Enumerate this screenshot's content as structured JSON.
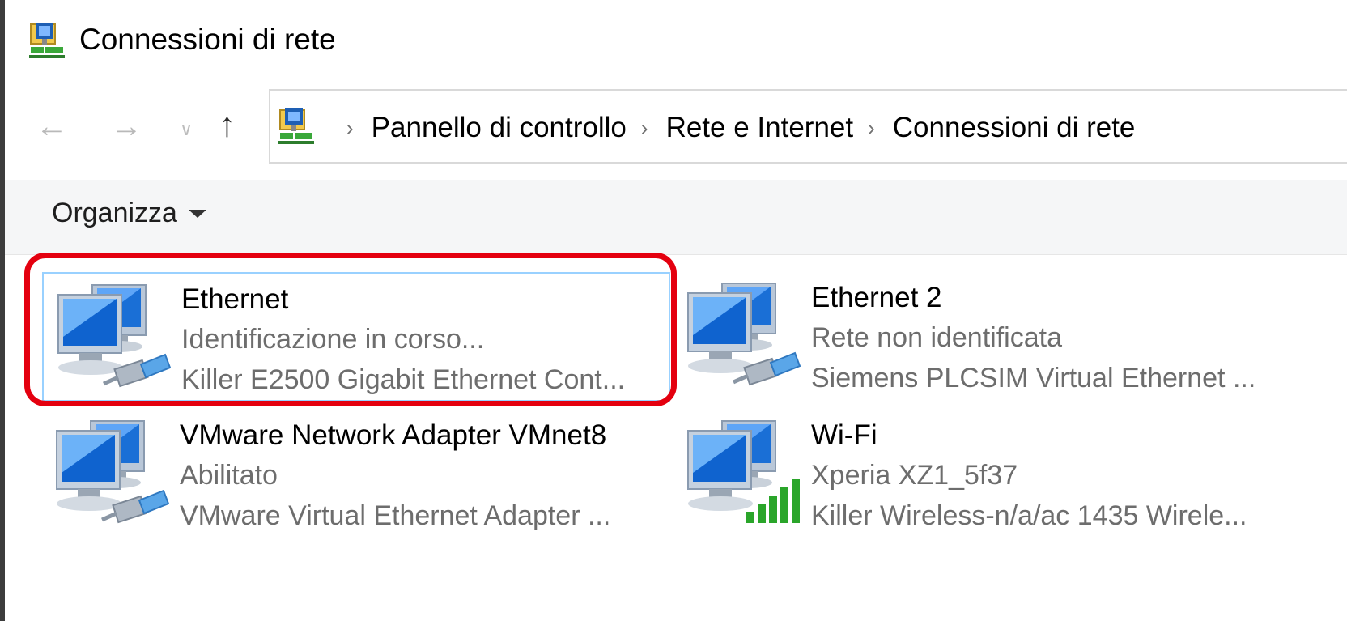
{
  "window": {
    "title": "Connessioni di rete"
  },
  "nav": {
    "back_icon": "back-arrow-icon",
    "forward_icon": "forward-arrow-icon",
    "recent_icon": "chevron-down-icon",
    "up_icon": "up-arrow-icon"
  },
  "breadcrumbs": [
    "Pannello di controllo",
    "Rete e Internet",
    "Connessioni di rete"
  ],
  "toolbar": {
    "organize_label": "Organizza"
  },
  "connections": [
    {
      "name": "Ethernet",
      "status": "Identificazione in corso...",
      "device": "Killer E2500 Gigabit Ethernet Cont...",
      "type": "ethernet"
    },
    {
      "name": "Ethernet 2",
      "status": "Rete non identificata",
      "device": "Siemens PLCSIM Virtual Ethernet ...",
      "type": "ethernet"
    },
    {
      "name": "VMware Network Adapter VMnet8",
      "status": "Abilitato",
      "device": "VMware Virtual Ethernet Adapter ...",
      "type": "ethernet"
    },
    {
      "name": "Wi-Fi",
      "status": "Xperia XZ1_5f37",
      "device": "Killer Wireless-n/a/ac 1435 Wirele...",
      "type": "wifi"
    }
  ],
  "colors": {
    "highlight": "#e4000f",
    "selection_border": "#99d1ff",
    "signal_green": "#2aa52a"
  }
}
